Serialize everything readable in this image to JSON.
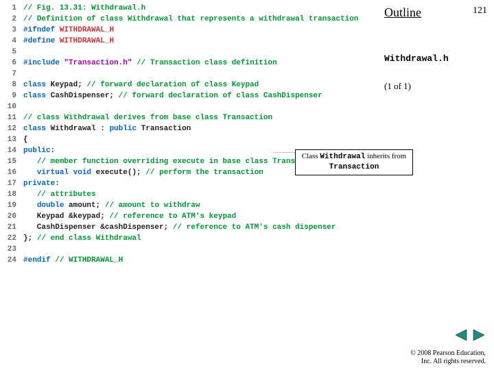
{
  "header": {
    "outline": "Outline",
    "page": "121",
    "filename": "Withdrawal.h",
    "pager": "(1 of 1)"
  },
  "callout": {
    "pre": "Class ",
    "cls1": "Withdrawal",
    "mid": " inherits from ",
    "cls2": "Transaction"
  },
  "code": [
    {
      "n": "1",
      "seg": [
        {
          "c": "green",
          "t": "// Fig. 13.31: Withdrawal.h"
        }
      ]
    },
    {
      "n": "2",
      "seg": [
        {
          "c": "green",
          "t": "// Definition of class Withdrawal that represents a withdrawal transaction"
        }
      ]
    },
    {
      "n": "3",
      "seg": [
        {
          "c": "blue",
          "t": "#ifndef"
        },
        {
          "c": "black",
          "t": " "
        },
        {
          "c": "red",
          "t": "WITHDRAWAL_H"
        }
      ]
    },
    {
      "n": "4",
      "seg": [
        {
          "c": "blue",
          "t": "#define"
        },
        {
          "c": "black",
          "t": " "
        },
        {
          "c": "red",
          "t": "WITHDRAWAL_H"
        }
      ]
    },
    {
      "n": "5",
      "seg": []
    },
    {
      "n": "6",
      "seg": [
        {
          "c": "blue",
          "t": "#include"
        },
        {
          "c": "black",
          "t": " "
        },
        {
          "c": "magenta",
          "t": "\"Transaction.h\""
        },
        {
          "c": "black",
          "t": " "
        },
        {
          "c": "green",
          "t": "// Transaction class definition"
        }
      ]
    },
    {
      "n": "7",
      "seg": []
    },
    {
      "n": "8",
      "seg": [
        {
          "c": "blue",
          "t": "class "
        },
        {
          "c": "black",
          "t": "Keypad; "
        },
        {
          "c": "green",
          "t": "// forward declaration of class Keypad"
        }
      ]
    },
    {
      "n": "9",
      "seg": [
        {
          "c": "blue",
          "t": "class "
        },
        {
          "c": "black",
          "t": "CashDispenser; "
        },
        {
          "c": "green",
          "t": "// forward declaration of class CashDispenser"
        }
      ]
    },
    {
      "n": "10",
      "seg": []
    },
    {
      "n": "11",
      "seg": [
        {
          "c": "green",
          "t": "// class Withdrawal derives from base class Transaction"
        }
      ]
    },
    {
      "n": "12",
      "seg": [
        {
          "c": "blue",
          "t": "class "
        },
        {
          "c": "black",
          "t": "Withdrawal : "
        },
        {
          "c": "blue",
          "t": "public "
        },
        {
          "c": "black",
          "t": "Transaction"
        }
      ]
    },
    {
      "n": "13",
      "seg": [
        {
          "c": "black",
          "t": "{"
        }
      ]
    },
    {
      "n": "14",
      "seg": [
        {
          "c": "blue",
          "t": "public"
        },
        {
          "c": "black",
          "t": ":"
        }
      ]
    },
    {
      "n": "15",
      "seg": [
        {
          "c": "black",
          "t": "   "
        },
        {
          "c": "green",
          "t": "// member function overriding execute in base class Transaction"
        }
      ]
    },
    {
      "n": "16",
      "seg": [
        {
          "c": "black",
          "t": "   "
        },
        {
          "c": "blue",
          "t": "virtual void "
        },
        {
          "c": "black",
          "t": "execute(); "
        },
        {
          "c": "green",
          "t": "// perform the transaction"
        }
      ]
    },
    {
      "n": "17",
      "seg": [
        {
          "c": "blue",
          "t": "private"
        },
        {
          "c": "black",
          "t": ":"
        }
      ]
    },
    {
      "n": "18",
      "seg": [
        {
          "c": "black",
          "t": "   "
        },
        {
          "c": "green",
          "t": "// attributes"
        }
      ]
    },
    {
      "n": "19",
      "seg": [
        {
          "c": "black",
          "t": "   "
        },
        {
          "c": "blue",
          "t": "double "
        },
        {
          "c": "black",
          "t": "amount; "
        },
        {
          "c": "green",
          "t": "// amount to withdraw"
        }
      ]
    },
    {
      "n": "20",
      "seg": [
        {
          "c": "black",
          "t": "   Keypad &keypad; "
        },
        {
          "c": "green",
          "t": "// reference to ATM's keypad"
        }
      ]
    },
    {
      "n": "21",
      "seg": [
        {
          "c": "black",
          "t": "   CashDispenser &cashDispenser; "
        },
        {
          "c": "green",
          "t": "// reference to ATM's cash dispenser"
        }
      ]
    },
    {
      "n": "22",
      "seg": [
        {
          "c": "black",
          "t": "}; "
        },
        {
          "c": "green",
          "t": "// end class Withdrawal"
        }
      ]
    },
    {
      "n": "23",
      "seg": []
    },
    {
      "n": "24",
      "seg": [
        {
          "c": "blue",
          "t": "#endif"
        },
        {
          "c": "black",
          "t": " "
        },
        {
          "c": "green",
          "t": "// WITHDRAWAL_H"
        }
      ]
    }
  ],
  "footer": {
    "copy1": "© 2008 Pearson Education,",
    "copy2": "Inc.  All rights reserved."
  }
}
